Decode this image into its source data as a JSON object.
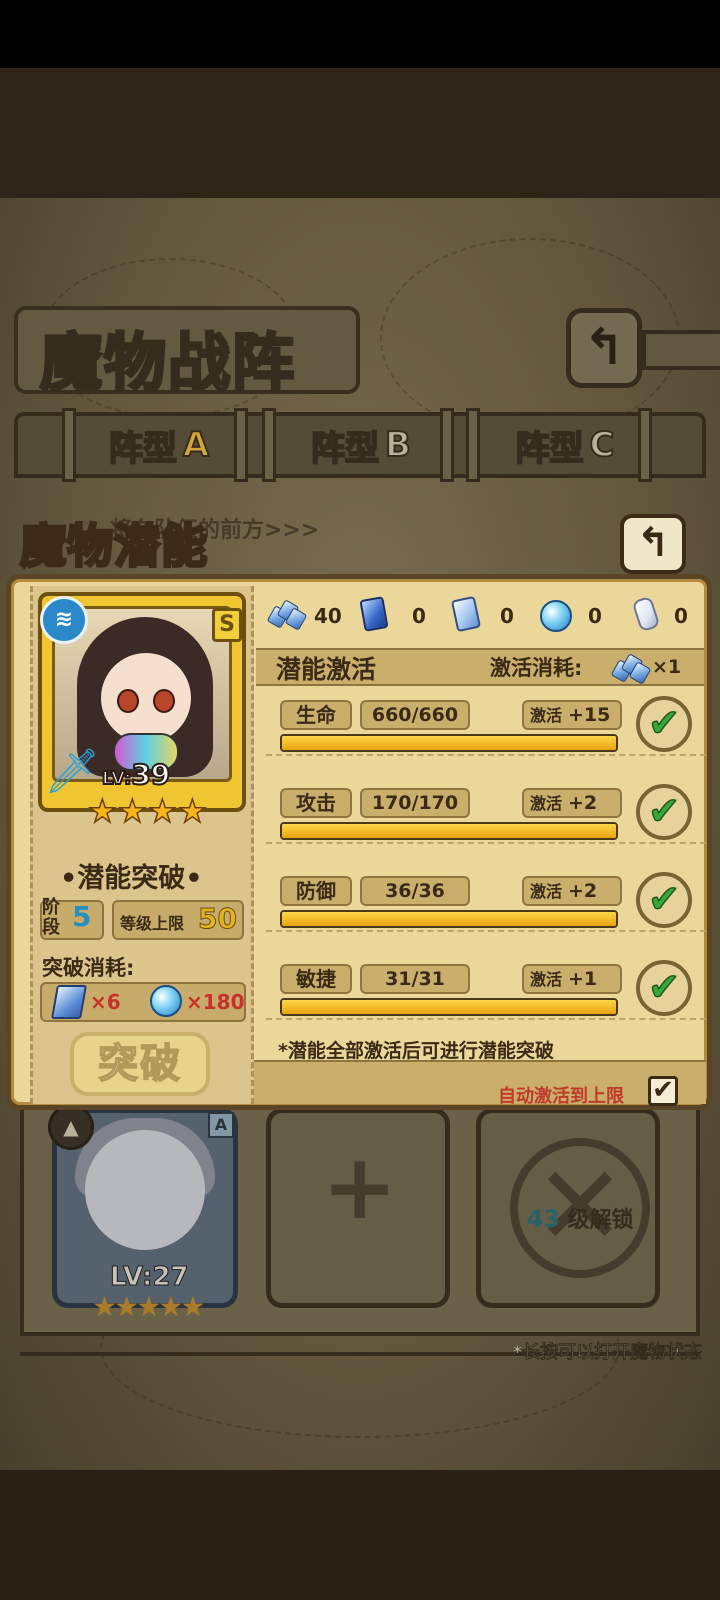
{
  "formation_screen": {
    "title": "魔物战阵",
    "tabs": [
      {
        "label": "阵型",
        "letter": "A"
      },
      {
        "label": "阵型",
        "letter": "B"
      },
      {
        "label": "阵型",
        "letter": "C"
      }
    ],
    "hint": "将在队伍的前方>>>",
    "hero_card": {
      "level": "LV:27",
      "rank": "A",
      "stars": "★★★★★"
    },
    "add_slot_symbol": "+",
    "locked_slot": {
      "level": "43",
      "text": "级解锁"
    },
    "footer_hint": "*长按可以打开魔物状态"
  },
  "potential_dialog": {
    "title": "魔物潜能",
    "back_icon": "↰",
    "monster": {
      "level_prefix": "LV:",
      "level": "39",
      "rank": "S",
      "element_icon": "water-icon",
      "stars": 4
    },
    "breakthrough": {
      "title": "•潜能突破•",
      "stage_label": "阶段",
      "stage_value": "5",
      "cap_label": "等级上限",
      "cap_value": "50",
      "cost_label": "突破消耗:",
      "cost_items": [
        {
          "icon": "blue-crystal-icon",
          "qty": "×6"
        },
        {
          "icon": "blue-orb-icon",
          "qty": "×180"
        }
      ],
      "button_label": "突破"
    },
    "currencies": [
      {
        "icon": "crystal-cluster-icon",
        "value": "40"
      },
      {
        "icon": "dark-blue-crystal-icon",
        "value": "0"
      },
      {
        "icon": "light-blue-crystal-icon",
        "value": "0"
      },
      {
        "icon": "blue-orb-icon",
        "value": "0"
      },
      {
        "icon": "white-crystal-icon",
        "value": "0"
      }
    ],
    "activation": {
      "title": "潜能激活",
      "cost_label": "激活消耗:",
      "cost_multiplier": "×1",
      "stats": [
        {
          "name": "生命",
          "value": "660/660",
          "action": "激活",
          "bonus": "+15",
          "progress": 1.0
        },
        {
          "name": "攻击",
          "value": "170/170",
          "action": "激活",
          "bonus": "+2",
          "progress": 1.0
        },
        {
          "name": "防御",
          "value": "36/36",
          "action": "激活",
          "bonus": "+2",
          "progress": 1.0
        },
        {
          "name": "敏捷",
          "value": "31/31",
          "action": "激活",
          "bonus": "+1",
          "progress": 1.0
        }
      ],
      "note": "*潜能全部激活后可进行潜能突破",
      "auto_label": "自动激活到上限",
      "auto_checked": true
    }
  }
}
